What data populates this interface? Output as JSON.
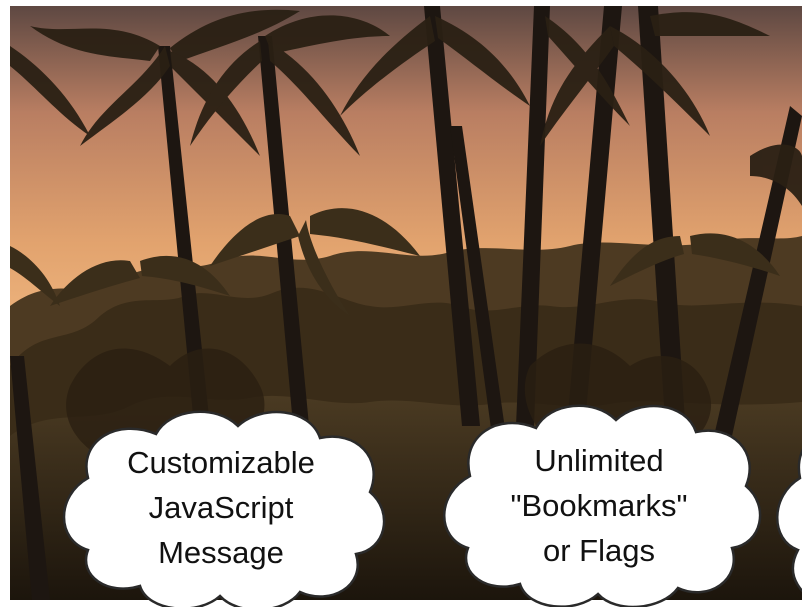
{
  "bubbles": [
    {
      "lines": [
        "Customizable",
        "JavaScript",
        "Message"
      ]
    },
    {
      "lines": [
        "Unlimited",
        "\"Bookmarks\"",
        "or Flags"
      ]
    }
  ],
  "colors": {
    "sky_top": "#6a5048",
    "sky_mid": "#d99a66",
    "sky_low": "#f2b77e",
    "foliage": "#2e2414",
    "trunk": "#1a1410",
    "bubble_fill": "#ffffff",
    "bubble_stroke": "#222222"
  }
}
